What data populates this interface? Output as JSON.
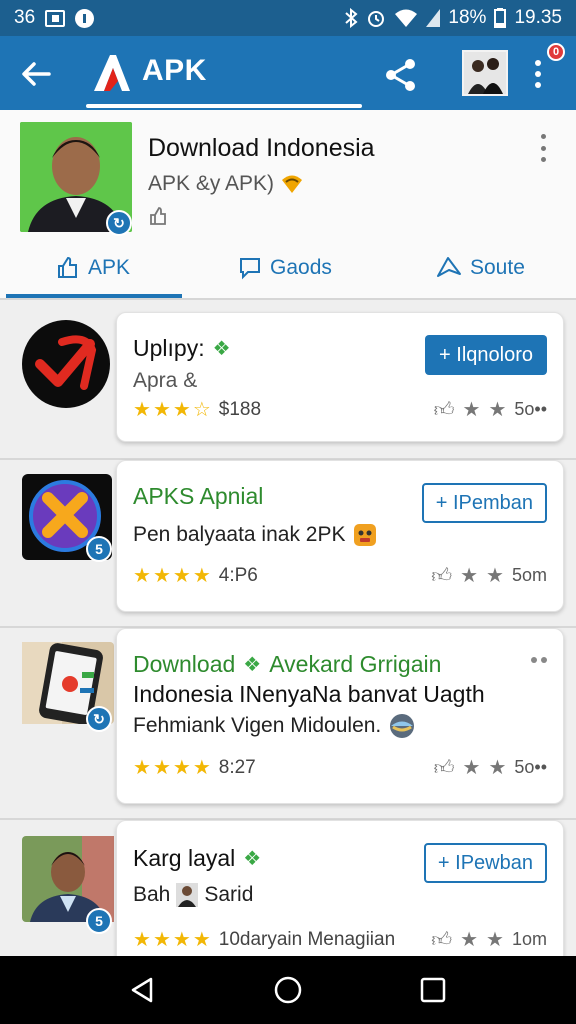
{
  "status_bar": {
    "left_number": "36",
    "battery": "18%",
    "time": "19.35"
  },
  "app_bar": {
    "title": "APK",
    "notification_count": "0"
  },
  "header": {
    "title": "Download Indonesia",
    "subtitle": "APK &y APK)",
    "tabs": [
      {
        "label": "APK"
      },
      {
        "label": "Gaods"
      },
      {
        "label": "Soute"
      }
    ]
  },
  "items": [
    {
      "title": "Uplıpy:",
      "subtitle": "Apra &",
      "rating_text": "$188",
      "button": "+ Ilqnoloro",
      "stat": "5o••"
    },
    {
      "title": "APKS Apnial",
      "subtitle": "Pen balyaata inak 2PK",
      "rating_text": "4:P6",
      "button": "+ IPemban",
      "stat": "5om",
      "badge": "5"
    },
    {
      "title": "Download",
      "title_suffix": "Avekard Grrigain",
      "line2": "Indonesia INenyaNa banvat Uagth",
      "line3": "Fehmiank Vigen Midoulen.",
      "rating_text": "8:27",
      "stat": "5o••"
    },
    {
      "title": "Karg layal",
      "subtitle_prefix": "Bah",
      "subtitle_suffix": "Sarid",
      "rating_text": "10daryain Menagiian",
      "button": "+ IPewban",
      "stat": "1om",
      "badge": "5"
    }
  ],
  "colors": {
    "primary": "#1e74b5",
    "status_bar": "#1c5f8f",
    "accent_green": "#2e8b2e",
    "star": "#f2b705"
  }
}
